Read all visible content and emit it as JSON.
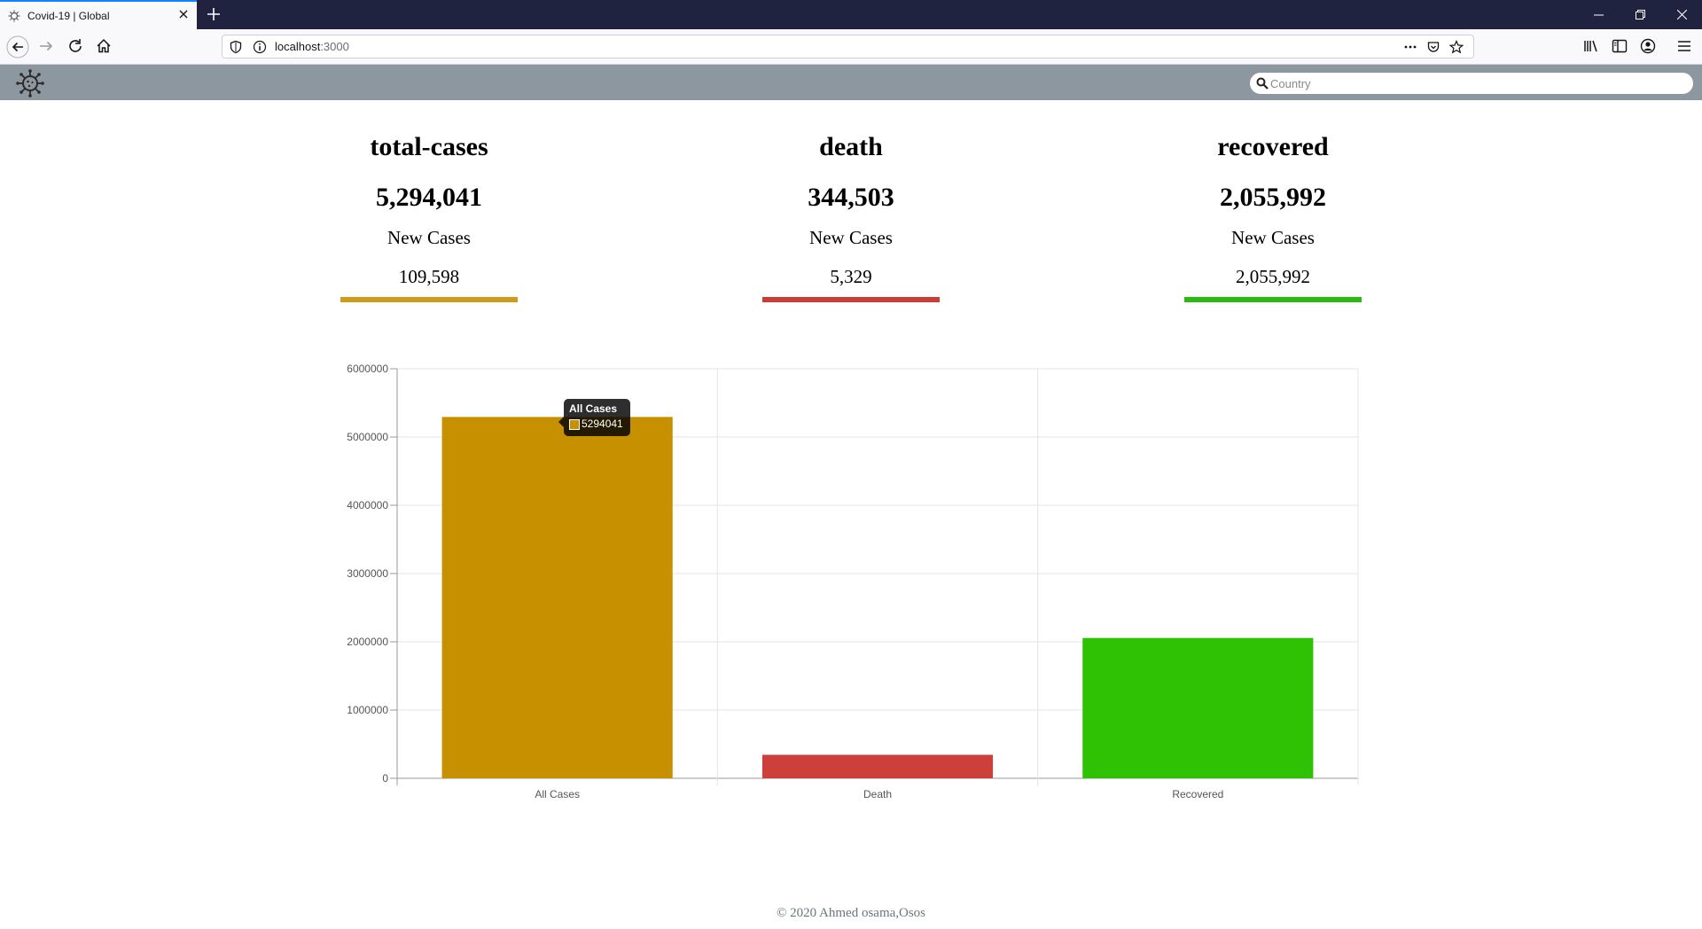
{
  "browser": {
    "tab_title": "Covid-19 | Global",
    "url_host": "localhost",
    "url_port": ":3000",
    "icons": [
      "back-icon",
      "forward-icon",
      "reload-icon",
      "home-icon",
      "shield-icon",
      "info-icon",
      "more-icon",
      "pocket-icon",
      "bookmark-star-icon",
      "library-icon",
      "sidebar-icon",
      "account-icon",
      "menu-icon"
    ]
  },
  "header": {
    "logo_icon": "virus-icon",
    "search_placeholder": "Country"
  },
  "stats": [
    {
      "label": "total-cases",
      "value": "5,294,041",
      "new_label": "New Cases",
      "new_value": "109,598",
      "color": "#d19b1a"
    },
    {
      "label": "death",
      "value": "344,503",
      "new_label": "New Cases",
      "new_value": "5,329",
      "color": "#cc3b36"
    },
    {
      "label": "recovered",
      "value": "2,055,992",
      "new_label": "New Cases",
      "new_value": "2,055,992",
      "color": "#2bb913"
    }
  ],
  "chart_data": {
    "type": "bar",
    "categories": [
      "All Cases",
      "Death",
      "Recovered"
    ],
    "values": [
      5294041,
      344503,
      2055992
    ],
    "colors": [
      "#c69000",
      "#cc3f3a",
      "#2fc104"
    ],
    "ylim": [
      0,
      6000000
    ],
    "yticks": [
      "0",
      "1000000",
      "2000000",
      "3000000",
      "4000000",
      "5000000",
      "6000000"
    ],
    "grid": true,
    "tooltip": {
      "title": "All Cases",
      "value": "5294041"
    }
  },
  "footer": {
    "text": "© 2020 Ahmed osama,Osos"
  }
}
